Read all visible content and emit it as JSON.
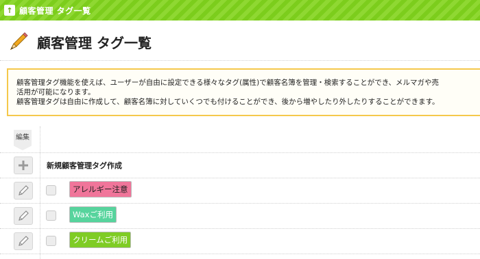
{
  "topbar": {
    "title": "顧客管理 タグ一覧"
  },
  "page": {
    "title": "顧客管理 タグ一覧"
  },
  "notice": {
    "line1": "顧客管理タグ機能を使えば、ユーザーが自由に設定できる様々なタグ(属性)で顧客名簿を管理・検索することができ、メルマガや売",
    "line2": "活用が可能になります。",
    "line3": "顧客管理タグは自由に作成して、顧客名簿に対していくつでも付けることができ、後から増やしたり外したりすることができます。"
  },
  "table": {
    "edit_header": "編集",
    "create_label": "新規顧客管理タグ作成",
    "tags": [
      {
        "label": "アレルギー注意",
        "bg": "#f0759a",
        "color": "#222222"
      },
      {
        "label": "Waxご利用",
        "bg": "#57d49d",
        "color": "#ffffff"
      },
      {
        "label": "クリームご利用",
        "bg": "#7fcc25",
        "color": "#ffffff"
      }
    ]
  },
  "icons": {
    "home": "home-icon",
    "title": "pencil-icon",
    "add": "plus-icon",
    "edit": "pencil-icon"
  }
}
